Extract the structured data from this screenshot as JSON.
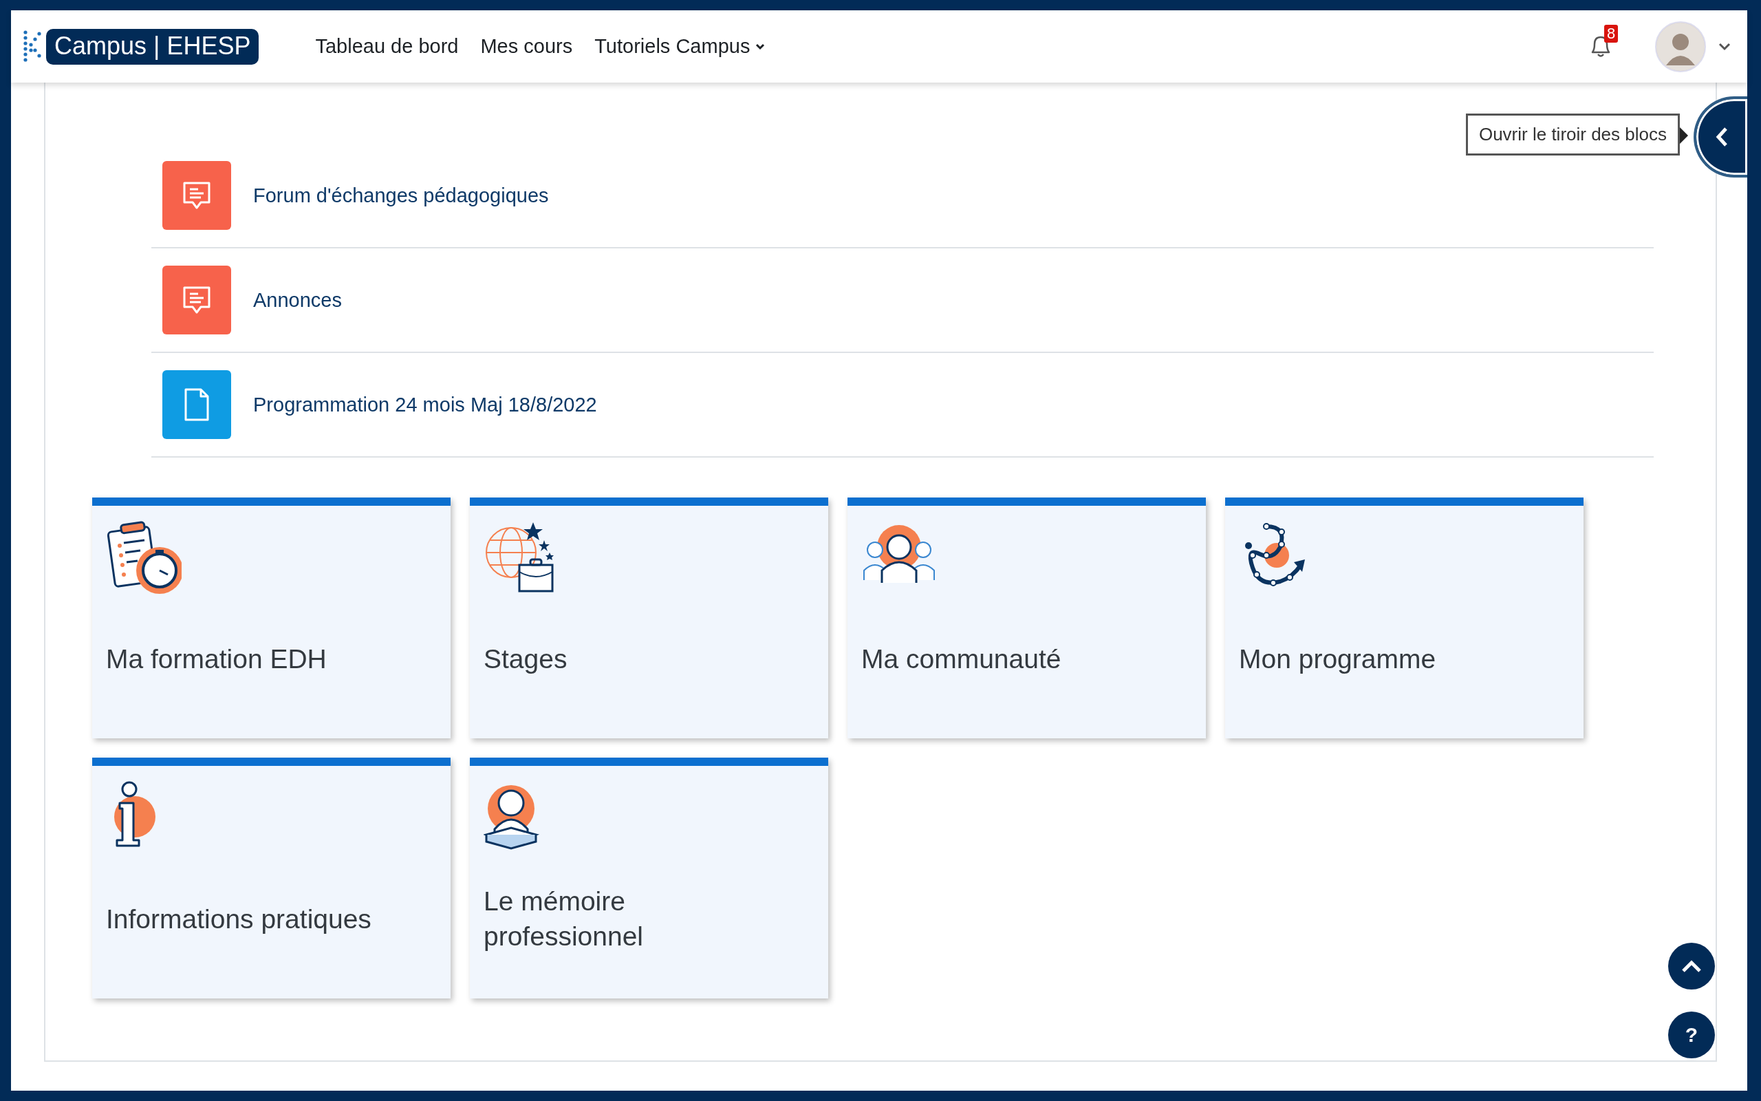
{
  "header": {
    "logo_text": "Campus | EHESP",
    "nav": [
      {
        "label": "Tableau de bord",
        "dropdown": false
      },
      {
        "label": "Mes cours",
        "dropdown": false
      },
      {
        "label": "Tutoriels Campus",
        "dropdown": true
      }
    ],
    "notification_count": "8"
  },
  "drawer_tooltip": "Ouvrir le tiroir des blocs",
  "activities": [
    {
      "title": "Forum d'échanges pédagogiques",
      "kind": "forum"
    },
    {
      "title": "Annonces",
      "kind": "forum"
    },
    {
      "title": "Programmation 24 mois Maj 18/8/2022",
      "kind": "file"
    }
  ],
  "tiles": [
    {
      "title": "Ma formation EDH",
      "kind": "clipboard"
    },
    {
      "title": "Stages",
      "kind": "globe"
    },
    {
      "title": "Ma communauté",
      "kind": "people"
    },
    {
      "title": "Mon programme",
      "kind": "path"
    },
    {
      "title": "Informations pratiques",
      "kind": "info"
    },
    {
      "title": "Le mémoire professionnel",
      "kind": "reader"
    }
  ],
  "help_button": "?"
}
